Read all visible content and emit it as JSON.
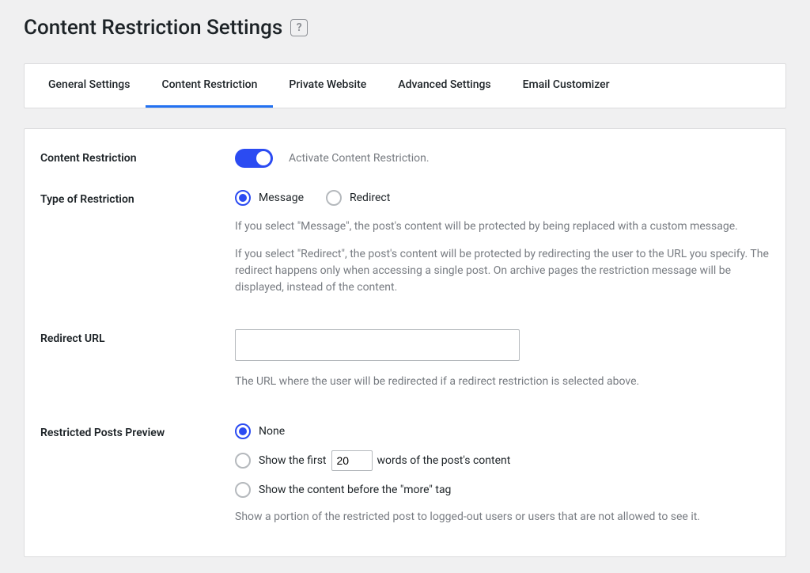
{
  "page": {
    "title": "Content Restriction Settings"
  },
  "tabs": [
    {
      "label": "General Settings",
      "active": false
    },
    {
      "label": "Content Restriction",
      "active": true
    },
    {
      "label": "Private Website",
      "active": false
    },
    {
      "label": "Advanced Settings",
      "active": false
    },
    {
      "label": "Email Customizer",
      "active": false
    }
  ],
  "sections": {
    "content_restriction": {
      "label": "Content Restriction",
      "hint": "Activate Content Restriction.",
      "enabled": true
    },
    "type_of_restriction": {
      "label": "Type of Restriction",
      "options": {
        "message": "Message",
        "redirect": "Redirect"
      },
      "selected": "message",
      "desc1": "If you select \"Message\", the post's content will be protected by being replaced with a custom message.",
      "desc2": "If you select \"Redirect\", the post's content will be protected by redirecting the user to the URL you specify. The redirect happens only when accessing a single post. On archive pages the restriction message will be displayed, instead of the content."
    },
    "redirect_url": {
      "label": "Redirect URL",
      "value": "",
      "desc": "The URL where the user will be redirected if a redirect restriction is selected above."
    },
    "preview": {
      "label": "Restricted Posts Preview",
      "options": {
        "none": "None",
        "words_before": "Show the first",
        "words_after": "words of the post's content",
        "words_value": "20",
        "more": "Show the content before the \"more\" tag"
      },
      "selected": "none",
      "desc": "Show a portion of the restricted post to logged-out users or users that are not allowed to see it."
    }
  }
}
